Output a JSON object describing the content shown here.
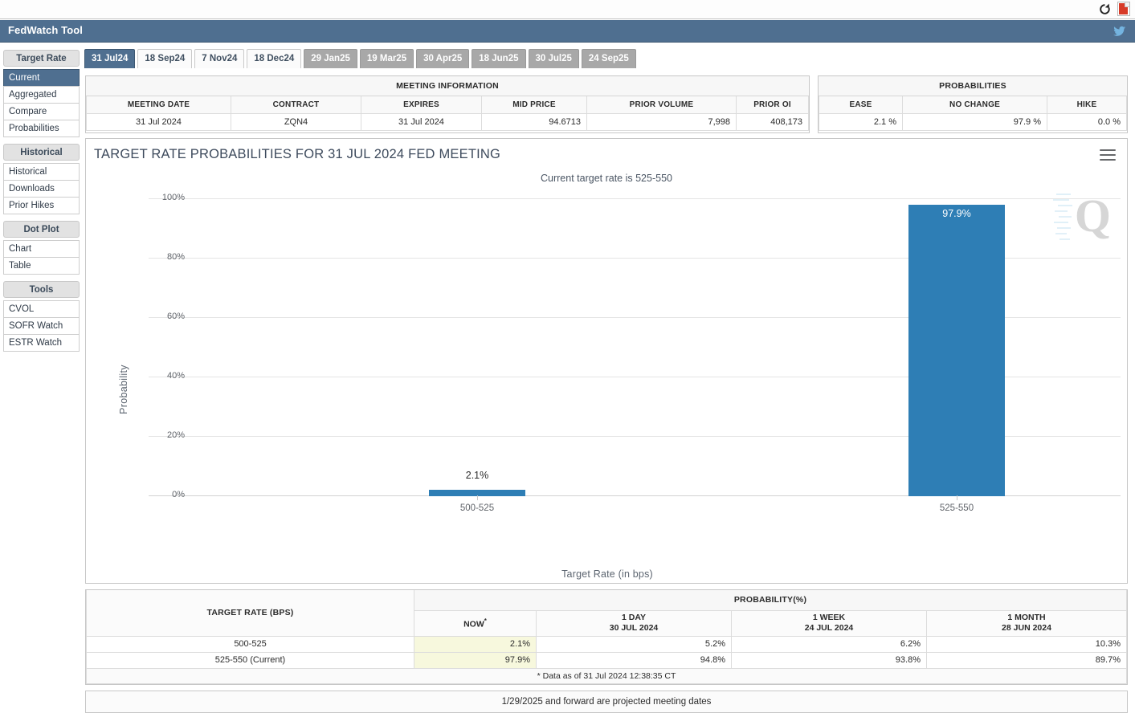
{
  "browser": {
    "reload_icon": "reload-icon",
    "pdf_icon": "pdf-icon"
  },
  "header": {
    "title": "FedWatch Tool",
    "twitter_icon": "twitter-icon"
  },
  "sidebar": {
    "groups": [
      {
        "title": "Target Rate",
        "items": [
          {
            "label": "Current",
            "active": true
          },
          {
            "label": "Aggregated",
            "active": false
          },
          {
            "label": "Compare",
            "active": false
          },
          {
            "label": "Probabilities",
            "active": false
          }
        ]
      },
      {
        "title": "Historical",
        "items": [
          {
            "label": "Historical",
            "active": false
          },
          {
            "label": "Downloads",
            "active": false
          },
          {
            "label": "Prior Hikes",
            "active": false
          }
        ]
      },
      {
        "title": "Dot Plot",
        "items": [
          {
            "label": "Chart",
            "active": false
          },
          {
            "label": "Table",
            "active": false
          }
        ]
      },
      {
        "title": "Tools",
        "items": [
          {
            "label": "CVOL",
            "active": false
          },
          {
            "label": "SOFR Watch",
            "active": false
          },
          {
            "label": "ESTR Watch",
            "active": false
          }
        ]
      }
    ]
  },
  "tabs": [
    {
      "label": "31 Jul24",
      "state": "active"
    },
    {
      "label": "18 Sep24",
      "state": "normal"
    },
    {
      "label": "7 Nov24",
      "state": "normal"
    },
    {
      "label": "18 Dec24",
      "state": "normal"
    },
    {
      "label": "29 Jan25",
      "state": "projected"
    },
    {
      "label": "19 Mar25",
      "state": "projected"
    },
    {
      "label": "30 Apr25",
      "state": "projected"
    },
    {
      "label": "18 Jun25",
      "state": "projected"
    },
    {
      "label": "30 Jul25",
      "state": "projected"
    },
    {
      "label": "24 Sep25",
      "state": "projected"
    }
  ],
  "meeting_information": {
    "title": "MEETING INFORMATION",
    "headers": [
      "MEETING DATE",
      "CONTRACT",
      "EXPIRES",
      "MID PRICE",
      "PRIOR VOLUME",
      "PRIOR OI"
    ],
    "row": {
      "meeting_date": "31 Jul 2024",
      "contract": "ZQN4",
      "expires": "31 Jul 2024",
      "mid_price": "94.6713",
      "prior_volume": "7,998",
      "prior_oi": "408,173"
    }
  },
  "probabilities_summary": {
    "title": "PROBABILITIES",
    "headers": [
      "EASE",
      "NO CHANGE",
      "HIKE"
    ],
    "row": {
      "ease": "2.1 %",
      "no_change": "97.9 %",
      "hike": "0.0 %"
    }
  },
  "chart_data": {
    "type": "bar",
    "title": "TARGET RATE PROBABILITIES FOR 31 JUL 2024 FED MEETING",
    "subtitle": "Current target rate is 525-550",
    "xlabel": "Target Rate (in bps)",
    "ylabel": "Probability",
    "categories": [
      "500-525",
      "525-550"
    ],
    "values": [
      2.1,
      97.9
    ],
    "value_labels": [
      "2.1%",
      "97.9%"
    ],
    "ylim": [
      0,
      100
    ],
    "yticks": [
      "0%",
      "20%",
      "40%",
      "60%",
      "80%",
      "100%"
    ],
    "ytick_values": [
      0,
      20,
      40,
      60,
      80,
      100
    ],
    "grid": true,
    "legend": "none",
    "bar_color": "#2e7eb5",
    "watermark": "Q",
    "menu_icon": "hamburger-menu-icon"
  },
  "probability_table": {
    "rate_header": "TARGET RATE (BPS)",
    "group_header": "PROBABILITY(%)",
    "columns": [
      {
        "line1": "NOW",
        "line2": "",
        "starred": true
      },
      {
        "line1": "1 DAY",
        "line2": "30 JUL 2024",
        "starred": false
      },
      {
        "line1": "1 WEEK",
        "line2": "24 JUL 2024",
        "starred": false
      },
      {
        "line1": "1 MONTH",
        "line2": "28 JUN 2024",
        "starred": false
      }
    ],
    "rows": [
      {
        "rate": "500-525",
        "now": "2.1%",
        "day": "5.2%",
        "week": "6.2%",
        "month": "10.3%"
      },
      {
        "rate": "525-550 (Current)",
        "now": "97.9%",
        "day": "94.8%",
        "week": "93.8%",
        "month": "89.7%"
      }
    ],
    "footnote": "* Data as of 31 Jul 2024 12:38:35 CT"
  },
  "footer": {
    "projected_note": "1/29/2025 and forward are projected meeting dates"
  }
}
